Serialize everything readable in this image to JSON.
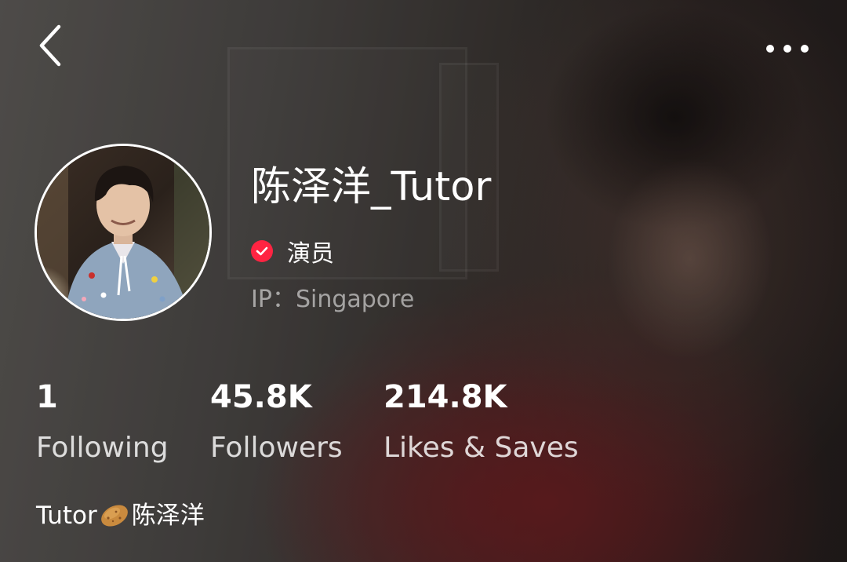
{
  "header": {
    "back_icon": "chevron-left-icon",
    "more_icon": "more-horizontal-icon"
  },
  "profile": {
    "username": "陈泽洋_Tutor",
    "verified_icon": "verified-check-icon",
    "verified_label": "演员",
    "ip_location": "IP：Singapore"
  },
  "stats": [
    {
      "value": "1",
      "label": "Following"
    },
    {
      "value": "45.8K",
      "label": "Followers"
    },
    {
      "value": "214.8K",
      "label": "Likes & Saves"
    }
  ],
  "bio": {
    "before": "Tutor",
    "emoji_icon": "potato-emoji-icon",
    "after": "陈泽洋"
  },
  "colors": {
    "accent": "#ff2442",
    "text_primary": "#ffffff",
    "text_muted": "#a9a5a3"
  }
}
